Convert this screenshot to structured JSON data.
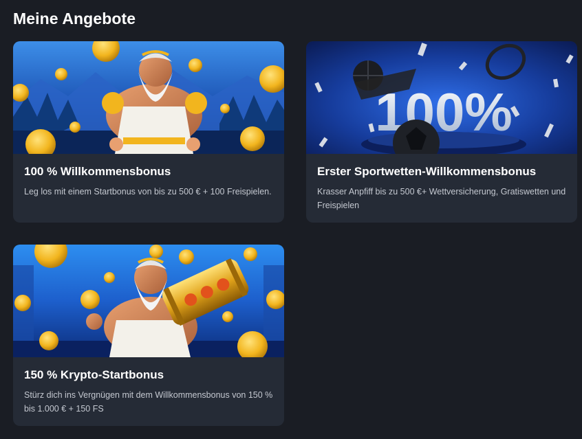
{
  "header": {
    "title": "Meine Angebote"
  },
  "offers": [
    {
      "title": "100 % Willkommensbonus",
      "description": "Leg los mit einem Startbonus von bis zu 500 € + 100 Freispielen.",
      "image_icon": "zeus-with-gold-coins-image"
    },
    {
      "title": "Erster Sportwetten-Willkommensbonus",
      "description": "Krasser Anpfiff bis zu 500 €+ Wettversicherung, Gratiswetten und Freispielen",
      "banner_text": "100%",
      "image_icon": "sports-balls-100-percent-image"
    },
    {
      "title": "150 % Krypto-Startbonus",
      "description": "Stürz dich ins Vergnügen mit dem Willkommensbonus von 150 % bis 1.000 € + 150 FS",
      "image_icon": "zeus-with-bitcoin-barrel-image"
    }
  ],
  "colors": {
    "page_background": "#1a1d24",
    "card_background": "#252b36",
    "title_text": "#ffffff",
    "description_text": "#c4c8d0",
    "coin_gold": "#f2b51e"
  }
}
